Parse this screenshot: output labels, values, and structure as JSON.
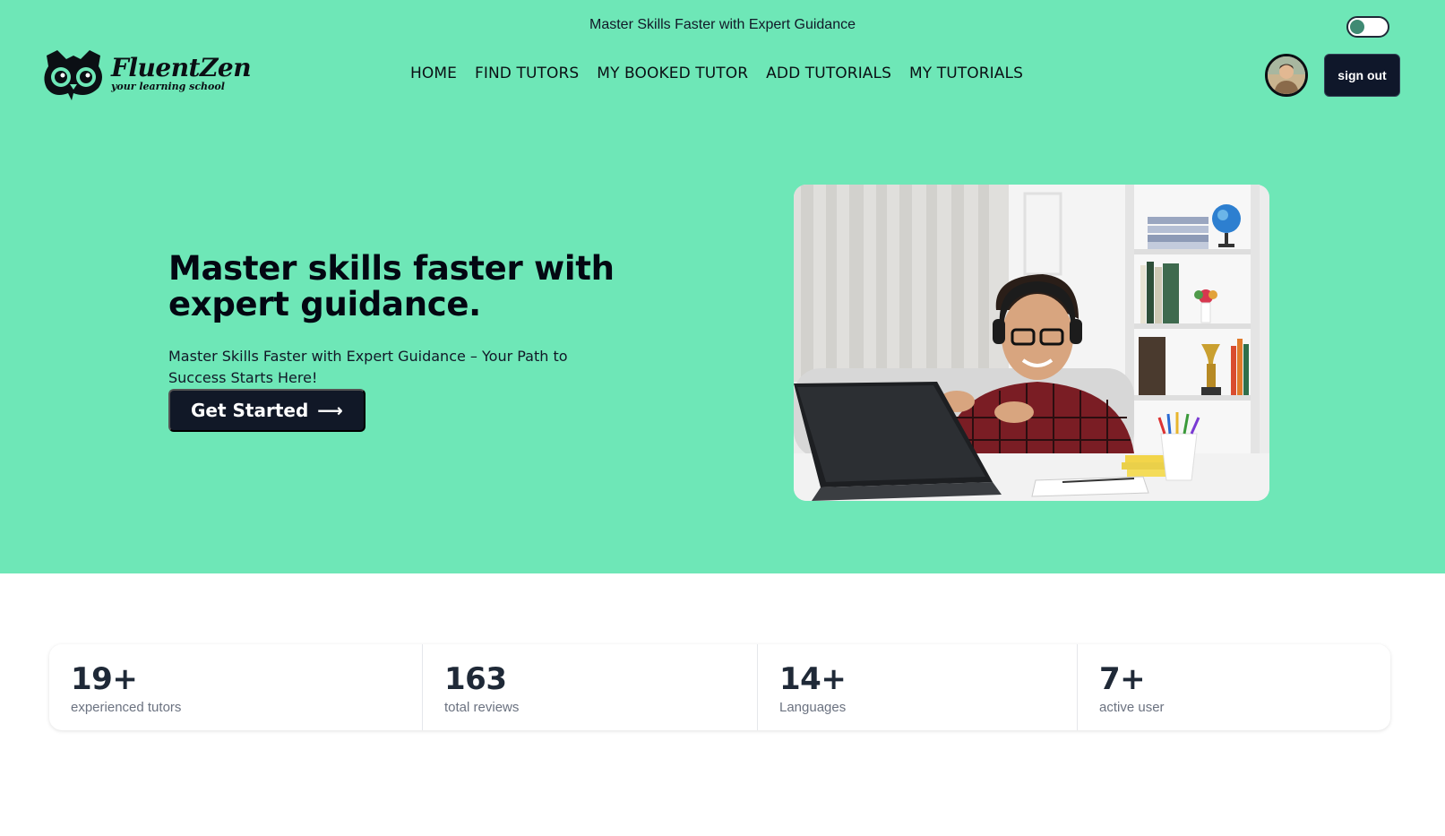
{
  "banner": {
    "text": "Master Skills Faster with Expert Guidance"
  },
  "theme_toggle": {
    "state": "off"
  },
  "brand": {
    "name": "FluentZen",
    "tagline": "your learning school",
    "logo_icon": "owl-icon"
  },
  "nav": {
    "items": [
      {
        "label": "HOME"
      },
      {
        "label": "FIND TUTORS"
      },
      {
        "label": "MY BOOKED TUTOR"
      },
      {
        "label": "ADD TUTORIALS"
      },
      {
        "label": "MY TUTORIALS"
      }
    ]
  },
  "user": {
    "signout_label": "sign out"
  },
  "hero": {
    "heading": "Master skills faster with expert guidance.",
    "subtitle": "Master Skills Faster with Expert Guidance – Your Path to Success Starts Here!",
    "cta_label": "Get Started",
    "cta_icon": "arrow-right-icon"
  },
  "stats": [
    {
      "value": "19+",
      "label": "experienced tutors"
    },
    {
      "value": "163",
      "label": "total reviews"
    },
    {
      "value": "14+",
      "label": "Languages"
    },
    {
      "value": "7+",
      "label": "active user"
    }
  ],
  "colors": {
    "hero_background": "#6ee7b7",
    "dark": "#0f172a",
    "muted_text": "#6b7280"
  }
}
